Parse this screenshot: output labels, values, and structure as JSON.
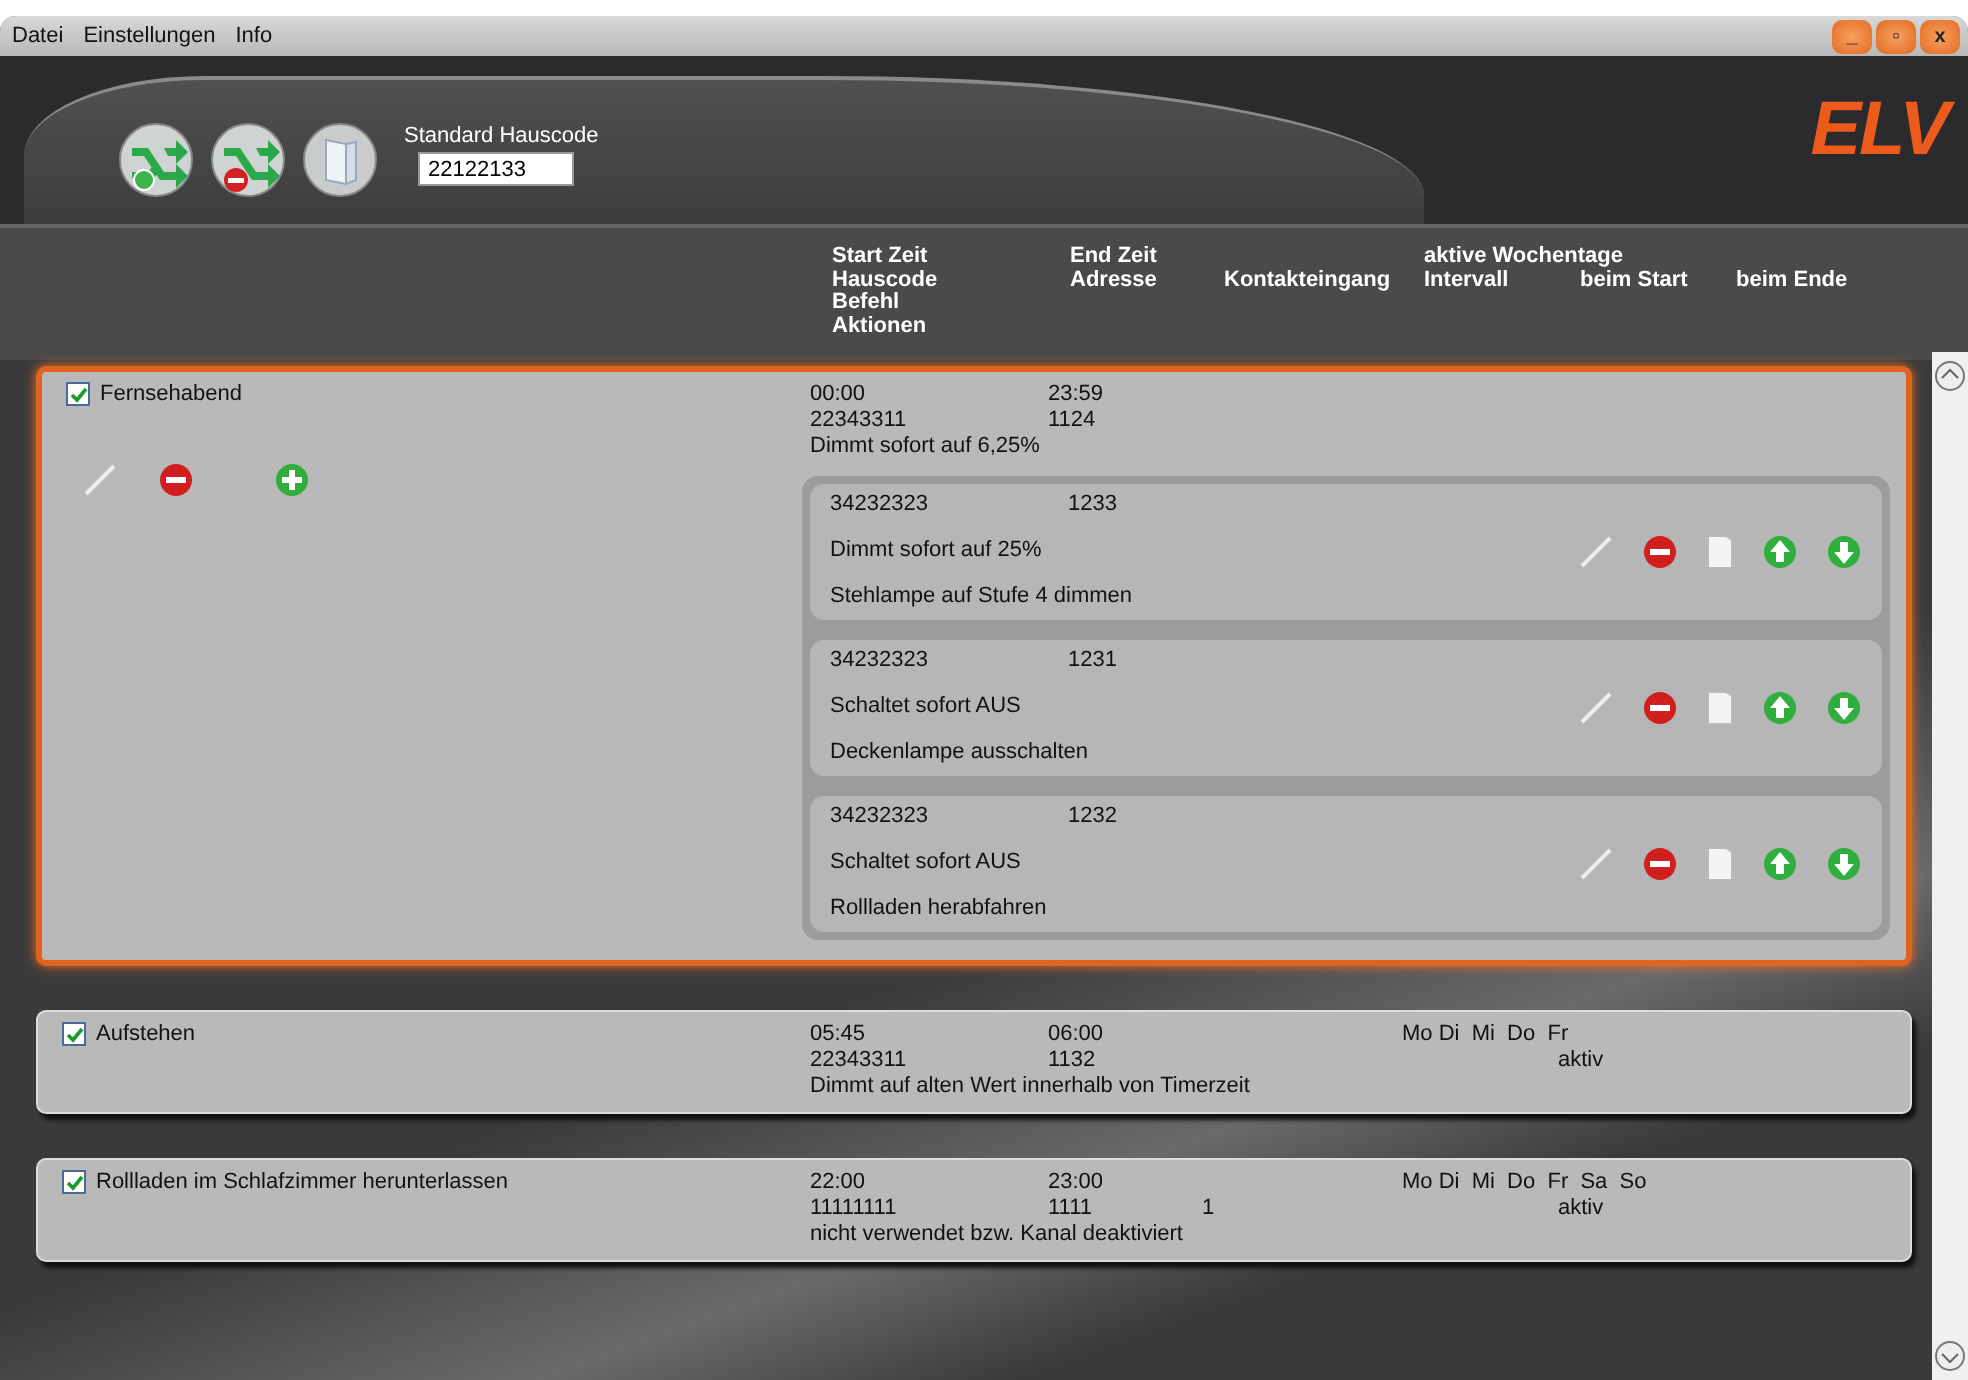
{
  "menu": [
    "Datei",
    "Einstellungen",
    "Info"
  ],
  "window_controls": [
    "_",
    "▫",
    "x"
  ],
  "logo": "ELV",
  "toolbar": {
    "hauscode_label": "Standard Hauscode",
    "hauscode_value": "22122133"
  },
  "columns": [
    {
      "kind": "top",
      "lines": [
        "Start Zeit",
        "Hauscode",
        "Befehl",
        "Aktionen"
      ]
    },
    {
      "kind": "top",
      "lines": [
        "End Zeit",
        "Adresse"
      ]
    },
    {
      "kind": "second",
      "lines": [
        "Kontakteingang"
      ]
    },
    {
      "kind": "top",
      "lines": [
        "aktive Wochentage",
        "Intervall"
      ]
    },
    {
      "kind": "second",
      "lines": [
        "beim Start"
      ]
    },
    {
      "kind": "second",
      "lines": [
        "beim Ende"
      ]
    }
  ],
  "timers": [
    {
      "name": "Fernsehabend",
      "checked": true,
      "expanded": true,
      "start": "00:00",
      "end": "23:59",
      "hauscode": "22343311",
      "adresse": "1124",
      "command": "Dimmt sofort auf 6,25%",
      "actions": [
        {
          "hauscode": "34232323",
          "adresse": "1233",
          "command": "Dimmt sofort auf 25%",
          "description": "Stehlampe auf Stufe 4 dimmen"
        },
        {
          "hauscode": "34232323",
          "adresse": "1231",
          "command": "Schaltet sofort AUS",
          "description": "Deckenlampe ausschalten"
        },
        {
          "hauscode": "34232323",
          "adresse": "1232",
          "command": "Schaltet sofort AUS",
          "description": "Rollladen herabfahren"
        }
      ]
    },
    {
      "name": "Aufstehen",
      "checked": true,
      "expanded": false,
      "start": "05:45",
      "end": "06:00",
      "hauscode": "22343311",
      "adresse": "1132",
      "command": "Dimmt auf alten Wert innerhalb von Timerzeit",
      "days": "Mo Di  Mi  Do  Fr",
      "beim_start": "aktiv"
    },
    {
      "name": "Rollladen im Schlafzimmer herunterlassen",
      "checked": true,
      "expanded": false,
      "start": "22:00",
      "end": "23:00",
      "hauscode": "11111111",
      "adresse": "1111",
      "kontakt": "1",
      "command": "nicht verwendet bzw. Kanal deaktiviert",
      "days": "Mo Di  Mi  Do  Fr  Sa  So",
      "beim_start": "aktiv"
    }
  ]
}
